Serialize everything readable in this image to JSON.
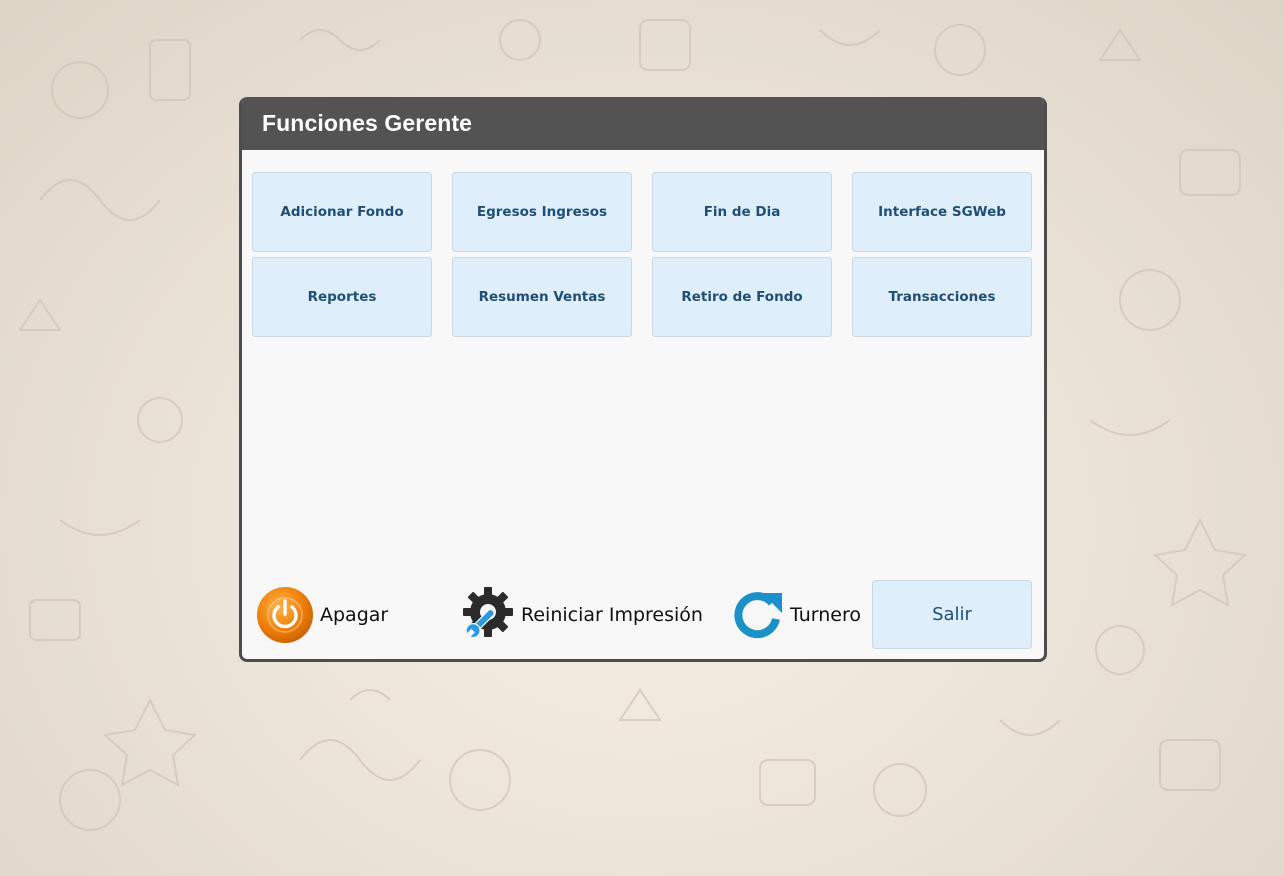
{
  "dialog": {
    "title": "Funciones Gerente"
  },
  "functions": [
    {
      "label": "Adicionar Fondo"
    },
    {
      "label": "Egresos Ingresos"
    },
    {
      "label": "Fin de Dia"
    },
    {
      "label": "Interface SGWeb"
    },
    {
      "label": "Reportes"
    },
    {
      "label": "Resumen Ventas"
    },
    {
      "label": "Retiro de Fondo"
    },
    {
      "label": "Transacciones"
    }
  ],
  "actions": {
    "apagar": {
      "label": "Apagar",
      "icon": "power-icon"
    },
    "reiniciar": {
      "label": "Reiniciar Impresión",
      "icon": "gear-wrench-icon"
    },
    "turnero": {
      "label": "Turnero",
      "icon": "refresh-icon"
    },
    "salir": {
      "label": "Salir"
    }
  },
  "colors": {
    "header_bg": "#535353",
    "button_bg": "#deeefb",
    "button_text": "#1f4f78",
    "power_orange": "#f07f0a",
    "refresh_blue": "#1e90c8"
  }
}
